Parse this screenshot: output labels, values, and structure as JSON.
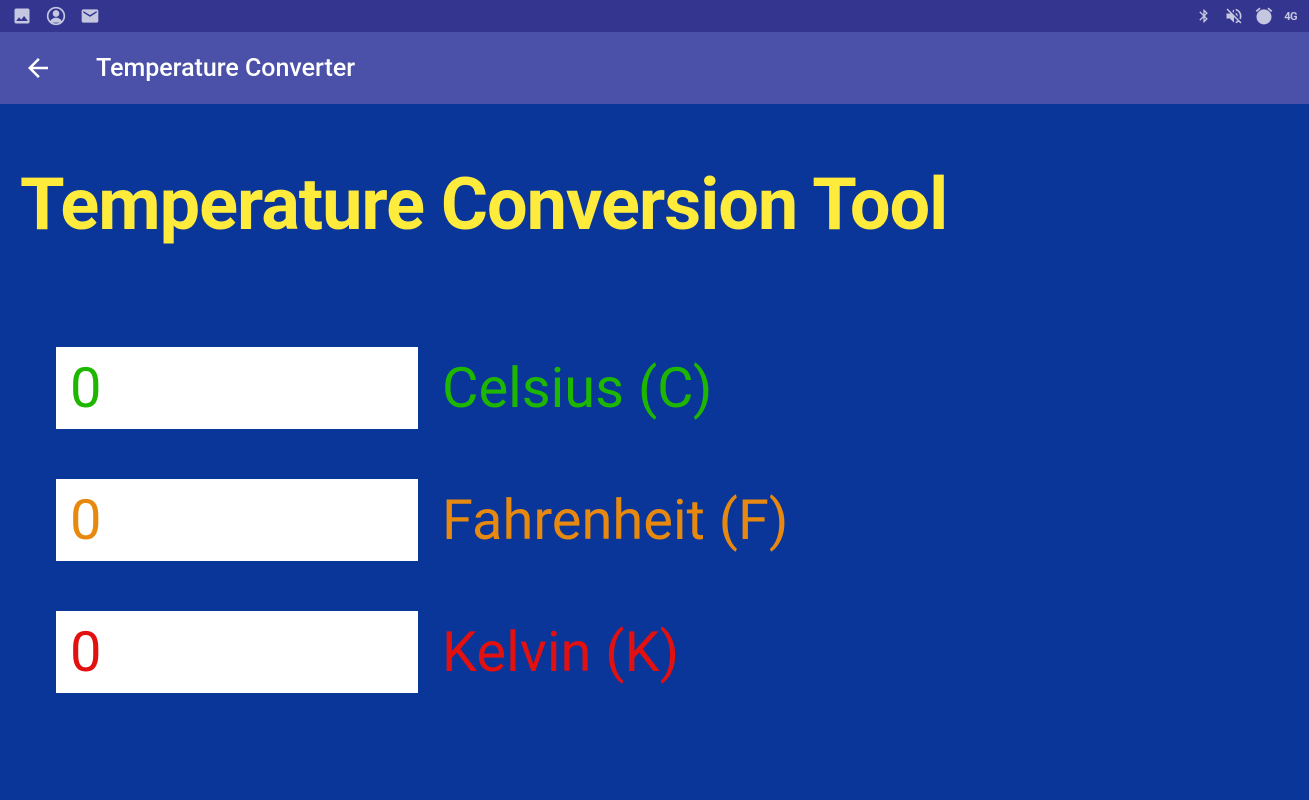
{
  "status_bar": {
    "network_indicator": "4G"
  },
  "app_bar": {
    "title": "Temperature Converter"
  },
  "main": {
    "heading": "Temperature Conversion Tool",
    "fields": {
      "celsius": {
        "value": "0",
        "label": "Celsius (C)"
      },
      "fahrenheit": {
        "value": "0",
        "label": "Fahrenheit (F)"
      },
      "kelvin": {
        "value": "0",
        "label": "Kelvin (K)"
      }
    }
  }
}
